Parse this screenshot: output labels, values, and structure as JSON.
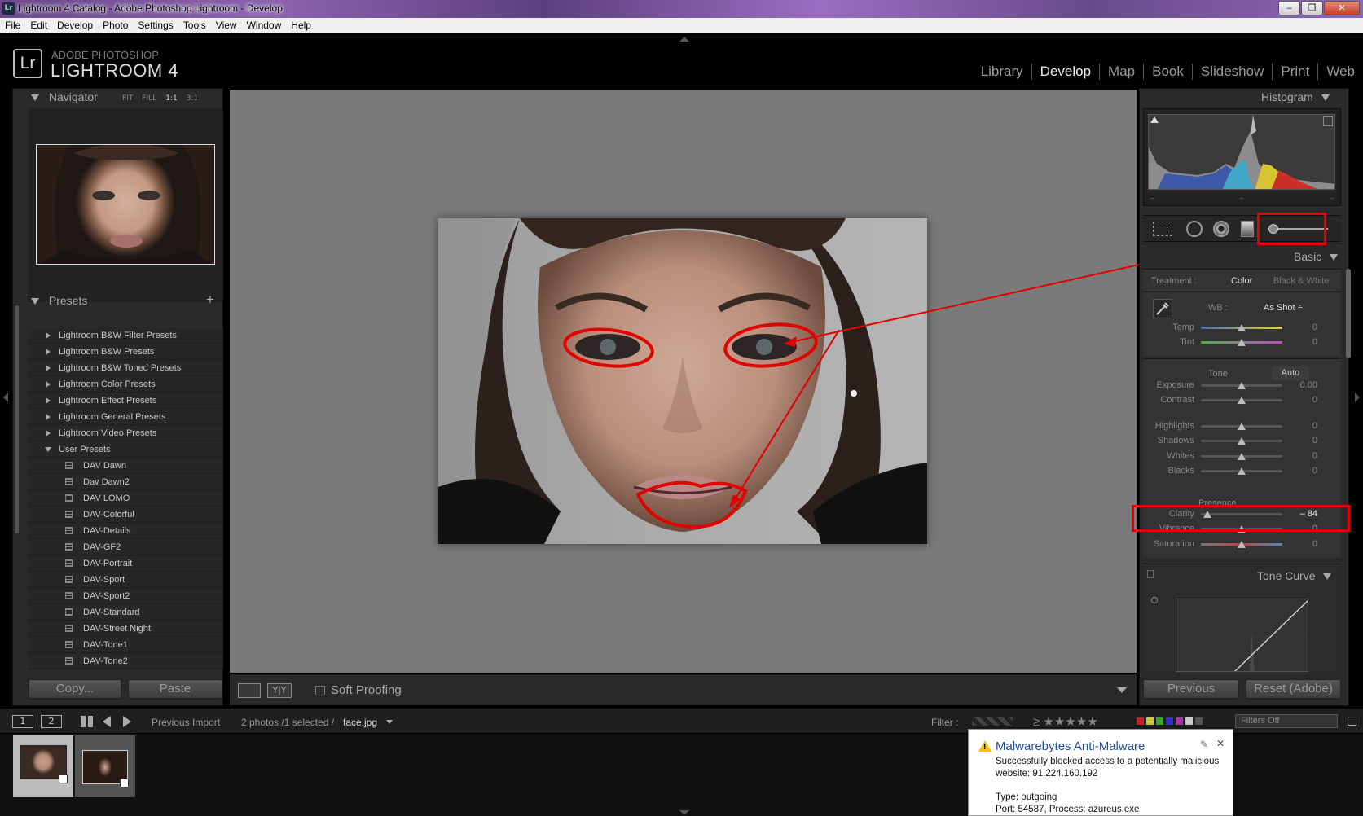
{
  "window": {
    "title": "Lightroom 4 Catalog - Adobe Photoshop Lightroom - Develop",
    "app_icon": "Lr",
    "minimize": "‒",
    "maximize": "❐",
    "close": "✕"
  },
  "menu": [
    "File",
    "Edit",
    "Develop",
    "Photo",
    "Settings",
    "Tools",
    "View",
    "Window",
    "Help"
  ],
  "identity": {
    "logo": "Lr",
    "line1": "ADOBE PHOTOSHOP",
    "line2": "LIGHTROOM 4"
  },
  "modules": {
    "items": [
      "Library",
      "Develop",
      "Map",
      "Book",
      "Slideshow",
      "Print",
      "Web"
    ],
    "active": "Develop"
  },
  "navigator": {
    "title": "Navigator",
    "options": [
      "FIT",
      "FILL",
      "1:1",
      "3:1"
    ],
    "active_option": "1:1"
  },
  "presets": {
    "title": "Presets",
    "add": "+",
    "folders": [
      "Lightroom B&W Filter Presets",
      "Lightroom B&W Presets",
      "Lightroom B&W Toned Presets",
      "Lightroom Color Presets",
      "Lightroom Effect Presets",
      "Lightroom General Presets",
      "Lightroom Video Presets",
      "User Presets"
    ],
    "user_presets": [
      "DAV Dawn",
      "Dav Dawn2",
      "DAV LOMO",
      "DAV-Colorful",
      "DAV-Details",
      "DAV-GF2",
      "DAV-Portrait",
      "DAV-Sport",
      "DAV-Sport2",
      "DAV-Standard",
      "DAV-Street Night",
      "DAV-Tone1",
      "DAV-Tone2"
    ]
  },
  "left_buttons": {
    "copy": "Copy...",
    "paste": "Paste"
  },
  "toolbar": {
    "soft_proofing": "Soft Proofing",
    "compare": "Y|Y"
  },
  "right": {
    "histogram_title": "Histogram",
    "hist_marks": [
      "–",
      "–",
      "–"
    ],
    "basic_title": "Basic",
    "treatment_label": "Treatment :",
    "treatment_color": "Color",
    "treatment_bw": "Black & White",
    "wb_label": "WB :",
    "wb_value": "As Shot ÷",
    "tone_label": "Tone",
    "auto": "Auto",
    "presence_label": "Presence",
    "tone_curve_title": "Tone Curve",
    "sliders": [
      {
        "label": "Temp",
        "value": "0",
        "pos": 0.5
      },
      {
        "label": "Tint",
        "value": "0",
        "pos": 0.5
      },
      {
        "label": "Exposure",
        "value": "0.00",
        "pos": 0.5
      },
      {
        "label": "Contrast",
        "value": "0",
        "pos": 0.5
      },
      {
        "label": "Highlights",
        "value": "0",
        "pos": 0.5
      },
      {
        "label": "Shadows",
        "value": "0",
        "pos": 0.5
      },
      {
        "label": "Whites",
        "value": "0",
        "pos": 0.5
      },
      {
        "label": "Blacks",
        "value": "0",
        "pos": 0.5
      },
      {
        "label": "Clarity",
        "value": "– 84",
        "pos": 0.08
      },
      {
        "label": "Vibrance",
        "value": "0",
        "pos": 0.5
      },
      {
        "label": "Saturation",
        "value": "0",
        "pos": 0.5
      }
    ],
    "previous": "Previous",
    "reset": "Reset (Adobe)"
  },
  "filmbar": {
    "views": [
      "1",
      "2"
    ],
    "source": "Previous Import",
    "count": "2 photos /1 selected /",
    "filename": "face.jpg",
    "filter_label": "Filter :",
    "filters_off": "Filters Off",
    "stars": "≥ ★★★★★"
  },
  "popup": {
    "title": "Malwarebytes Anti-Malware",
    "line1": "Successfully blocked access to a potentially malicious",
    "line2": "website: 91.224.160.192",
    "line3": "Type: outgoing",
    "line4": "Port: 54587, Process: azureus.exe",
    "pin": "✎",
    "close": "✕"
  },
  "colors": {
    "annotation_red": "#e20000",
    "panel_bg": "#2a2a2a",
    "canvas_bg": "#7a7a7a"
  }
}
